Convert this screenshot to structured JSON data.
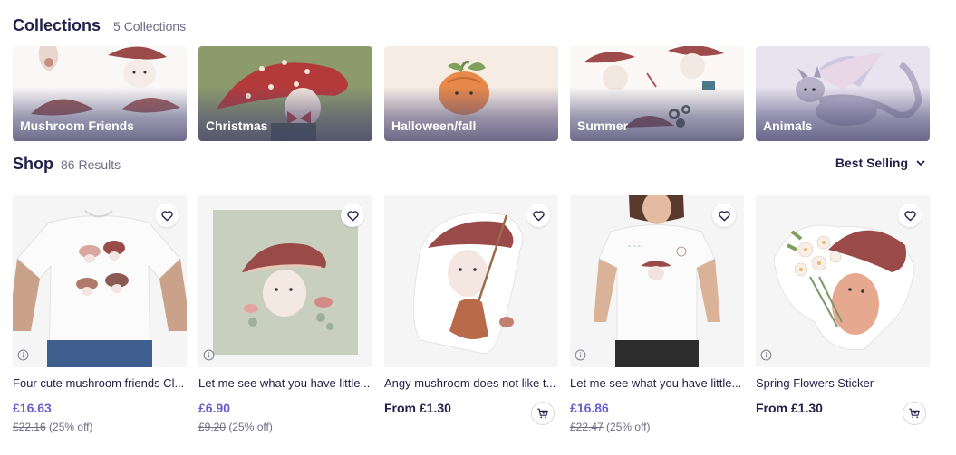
{
  "collections": {
    "title": "Collections",
    "count": "5 Collections",
    "items": [
      {
        "label": "Mushroom Friends"
      },
      {
        "label": "Christmas"
      },
      {
        "label": "Halloween/fall"
      },
      {
        "label": "Summer"
      },
      {
        "label": "Animals"
      }
    ]
  },
  "shop": {
    "title": "Shop",
    "count": "86 Results",
    "sort_label": "Best Selling"
  },
  "products": [
    {
      "title": "Four cute mushroom friends Cl...",
      "price": "£16.63",
      "old_price": "£22.16",
      "discount": "(25% off)"
    },
    {
      "title": "Let me see what you have little...",
      "price": "£6.90",
      "old_price": "£9.20",
      "discount": "(25% off)"
    },
    {
      "title": "Angy mushroom does not like t...",
      "price": "From £1.30"
    },
    {
      "title": "Let me see what you have little...",
      "price": "£16.86",
      "old_price": "£22.47",
      "discount": "(25% off)"
    },
    {
      "title": "Spring Flowers Sticker",
      "price": "From £1.30"
    }
  ],
  "colors": {
    "accent": "#6a5ecf",
    "heading": "#22214a",
    "muted": "#6e6c84"
  },
  "icons": [
    "heart-icon",
    "info-icon",
    "add-to-cart-icon",
    "chevron-down-icon"
  ]
}
